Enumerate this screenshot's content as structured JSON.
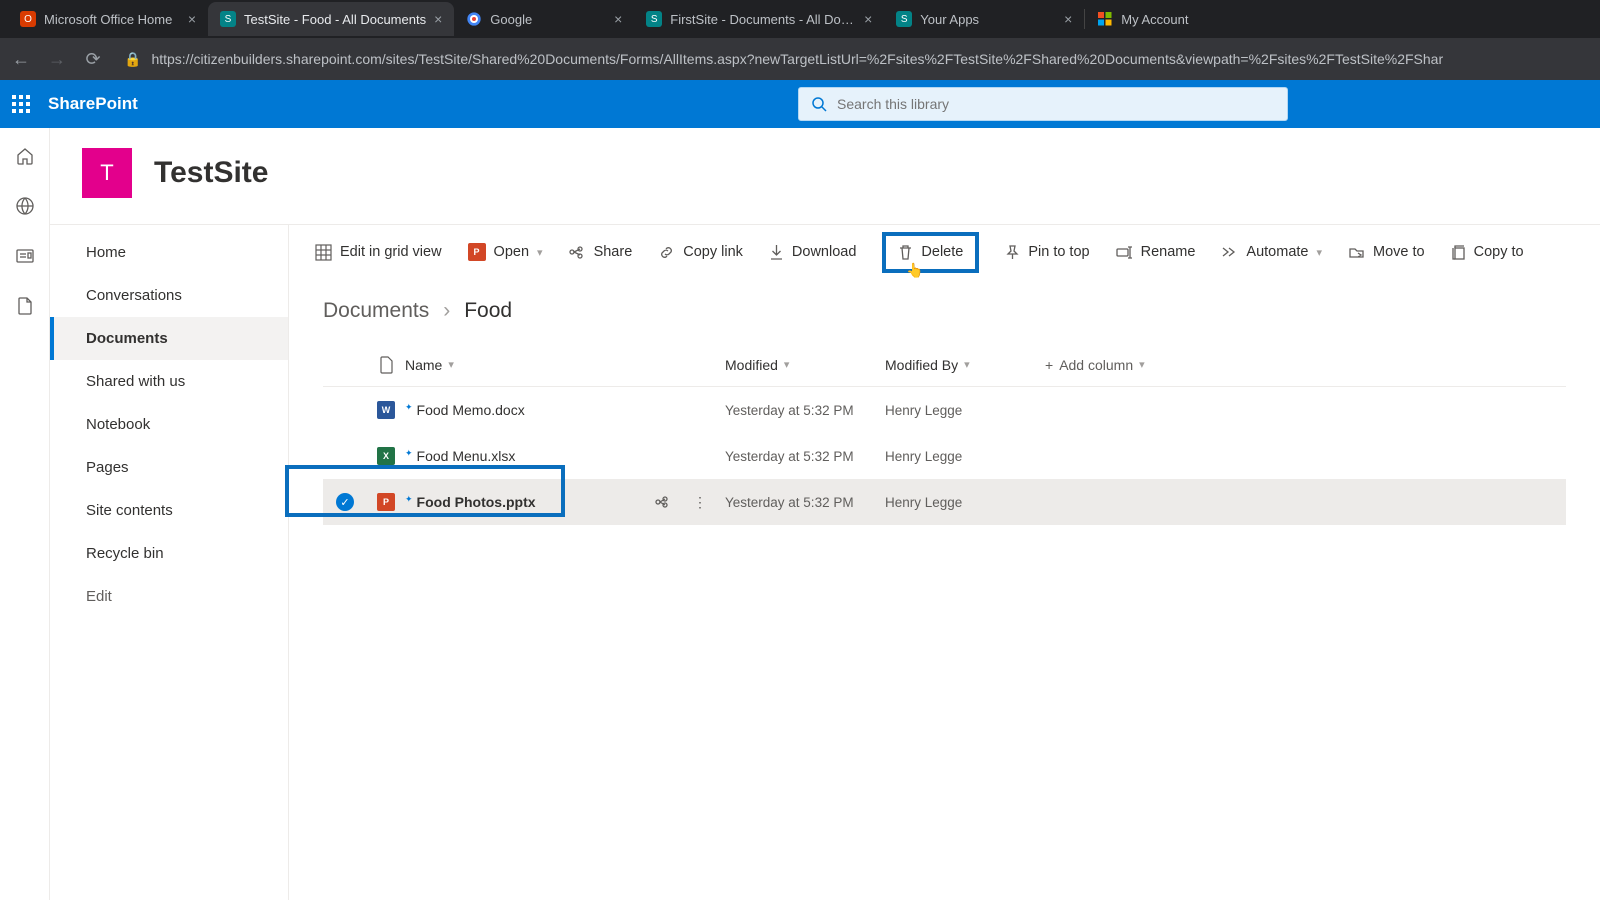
{
  "browser": {
    "tabs": [
      {
        "title": "Microsoft Office Home",
        "icon_bg": "#d83b01"
      },
      {
        "title": "TestSite - Food - All Documents",
        "icon_bg": "#038387",
        "active": true
      },
      {
        "title": "Google",
        "icon_bg": ""
      },
      {
        "title": "FirstSite - Documents - All Docum",
        "icon_bg": "#038387"
      },
      {
        "title": "Your Apps",
        "icon_bg": "#038387"
      },
      {
        "title": "My Account",
        "icon_bg": ""
      }
    ],
    "url": "https://citizenbuilders.sharepoint.com/sites/TestSite/Shared%20Documents/Forms/AllItems.aspx?newTargetListUrl=%2Fsites%2FTestSite%2FShared%20Documents&viewpath=%2Fsites%2FTestSite%2FShar"
  },
  "suite": {
    "brand": "SharePoint",
    "search_placeholder": "Search this library"
  },
  "site": {
    "logo_letter": "T",
    "title": "TestSite"
  },
  "nav": {
    "items": [
      "Home",
      "Conversations",
      "Documents",
      "Shared with us",
      "Notebook",
      "Pages",
      "Site contents",
      "Recycle bin",
      "Edit"
    ],
    "active_index": 2
  },
  "commands": {
    "edit_grid": "Edit in grid view",
    "open": "Open",
    "share": "Share",
    "copy_link": "Copy link",
    "download": "Download",
    "delete": "Delete",
    "pin": "Pin to top",
    "rename": "Rename",
    "automate": "Automate",
    "move": "Move to",
    "copy": "Copy to"
  },
  "breadcrumb": {
    "parent": "Documents",
    "current": "Food"
  },
  "columns": {
    "name": "Name",
    "modified": "Modified",
    "modified_by": "Modified By",
    "add": "Add column"
  },
  "files": [
    {
      "name": "Food Memo.docx",
      "type": "word",
      "modified": "Yesterday at 5:32 PM",
      "modified_by": "Henry Legge",
      "selected": false
    },
    {
      "name": "Food Menu.xlsx",
      "type": "excel",
      "modified": "Yesterday at 5:32 PM",
      "modified_by": "Henry Legge",
      "selected": false
    },
    {
      "name": "Food Photos.pptx",
      "type": "ppt",
      "modified": "Yesterday at 5:32 PM",
      "modified_by": "Henry Legge",
      "selected": true
    }
  ]
}
